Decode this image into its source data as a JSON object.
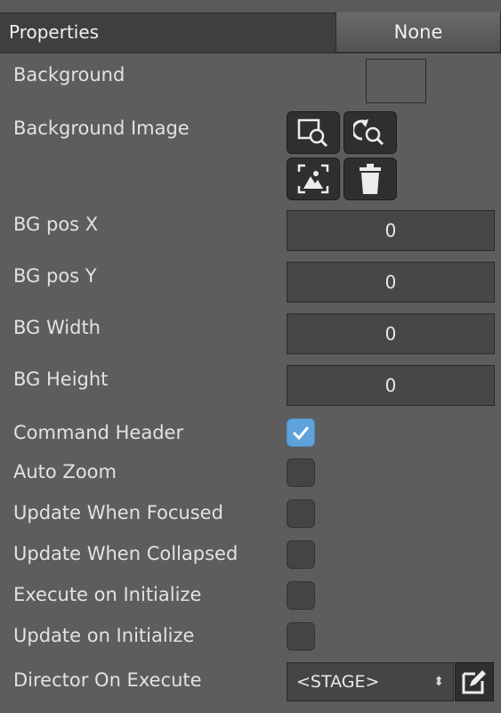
{
  "header": {
    "title": "Properties",
    "none_label": "None"
  },
  "labels": {
    "background": "Background",
    "background_image": "Background Image",
    "bg_pos_x": "BG pos X",
    "bg_pos_y": "BG pos Y",
    "bg_width": "BG Width",
    "bg_height": "BG Height",
    "command_header": "Command Header",
    "auto_zoom": "Auto Zoom",
    "update_when_focused": "Update When Focused",
    "update_when_collapsed": "Update When Collapsed",
    "execute_on_initialize": "Execute on Initialize",
    "update_on_initialize": "Update on Initialize",
    "director_on_execute": "Director On Execute"
  },
  "values": {
    "bg_pos_x": "0",
    "bg_pos_y": "0",
    "bg_width": "0",
    "bg_height": "0",
    "director": "<STAGE>"
  },
  "checkboxes": {
    "command_header": true,
    "auto_zoom": false,
    "update_when_focused": false,
    "update_when_collapsed": false,
    "execute_on_initialize": false,
    "update_on_initialize": false
  },
  "icons": {
    "browse": "image-search-icon",
    "refresh_search": "refresh-search-icon",
    "view_image": "image-view-icon",
    "delete": "trash-icon",
    "edit": "edit-icon"
  },
  "colors": {
    "panel_bg": "#5d5d5d",
    "header_bg": "#3f3f3f",
    "checkbox_checked": "#5ea2dc",
    "field_bg": "#474747"
  }
}
